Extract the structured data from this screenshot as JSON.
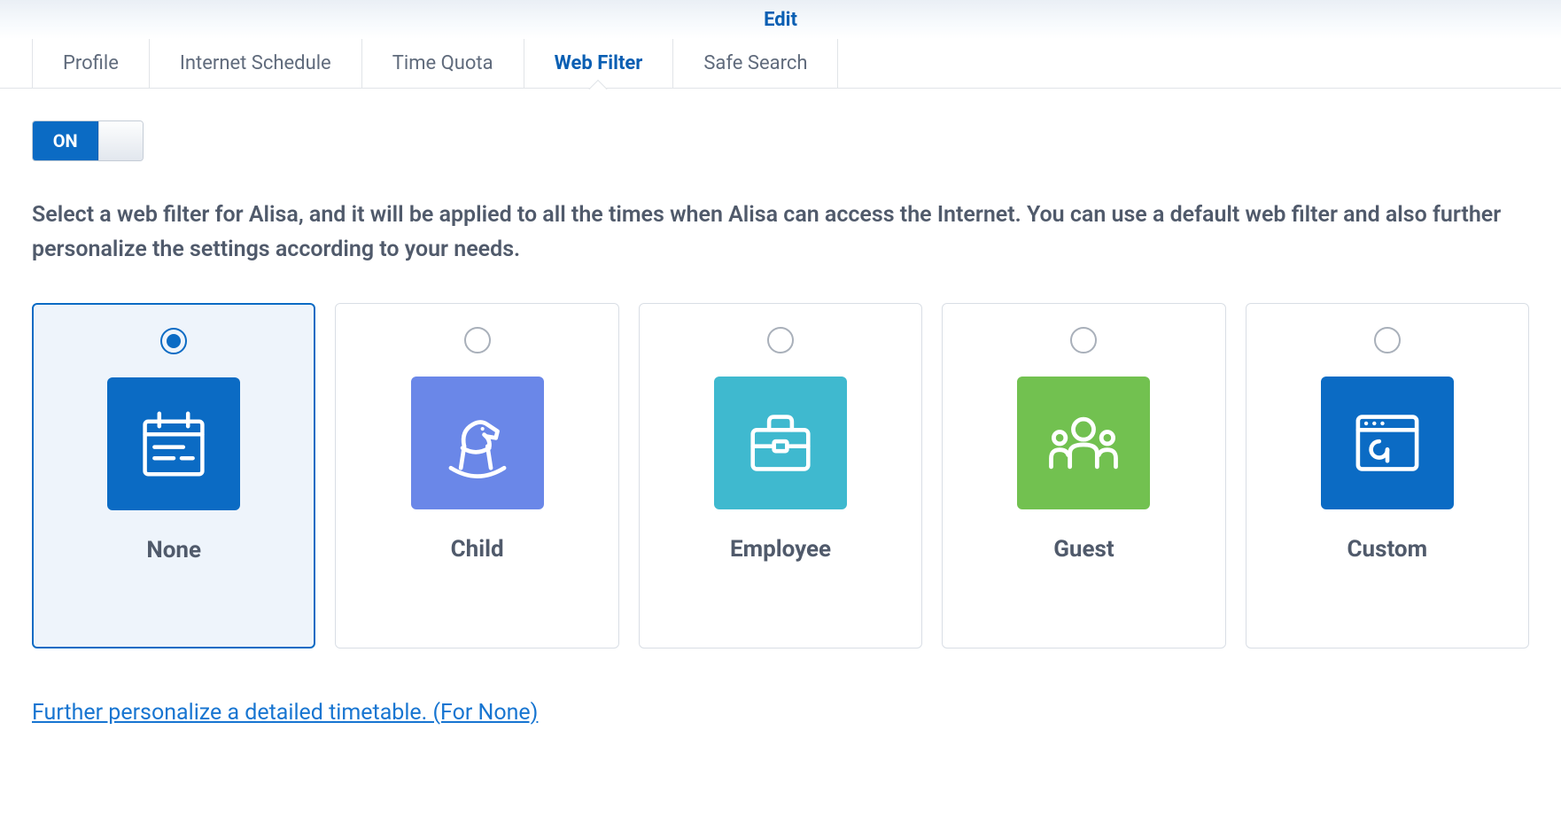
{
  "header": {
    "title": "Edit"
  },
  "tabs": [
    {
      "label": "Profile",
      "active": false
    },
    {
      "label": "Internet Schedule",
      "active": false
    },
    {
      "label": "Time Quota",
      "active": false
    },
    {
      "label": "Web Filter",
      "active": true
    },
    {
      "label": "Safe Search",
      "active": false
    }
  ],
  "toggle": {
    "state": "ON"
  },
  "description": "Select a web filter for Alisa, and it will be applied to all the times when Alisa can access the Internet. You can use a default web filter and also further personalize the settings according to your needs.",
  "filters": [
    {
      "label": "None",
      "icon": "calendar-notes-icon",
      "tile": "tile-blue",
      "selected": true
    },
    {
      "label": "Child",
      "icon": "rocking-horse-icon",
      "tile": "tile-indigo",
      "selected": false
    },
    {
      "label": "Employee",
      "icon": "briefcase-icon",
      "tile": "tile-teal",
      "selected": false
    },
    {
      "label": "Guest",
      "icon": "people-group-icon",
      "tile": "tile-green",
      "selected": false
    },
    {
      "label": "Custom",
      "icon": "browser-wrench-icon",
      "tile": "tile-dblue",
      "selected": false
    }
  ],
  "footer": {
    "link_text": "Further personalize a detailed timetable. (For None)"
  }
}
